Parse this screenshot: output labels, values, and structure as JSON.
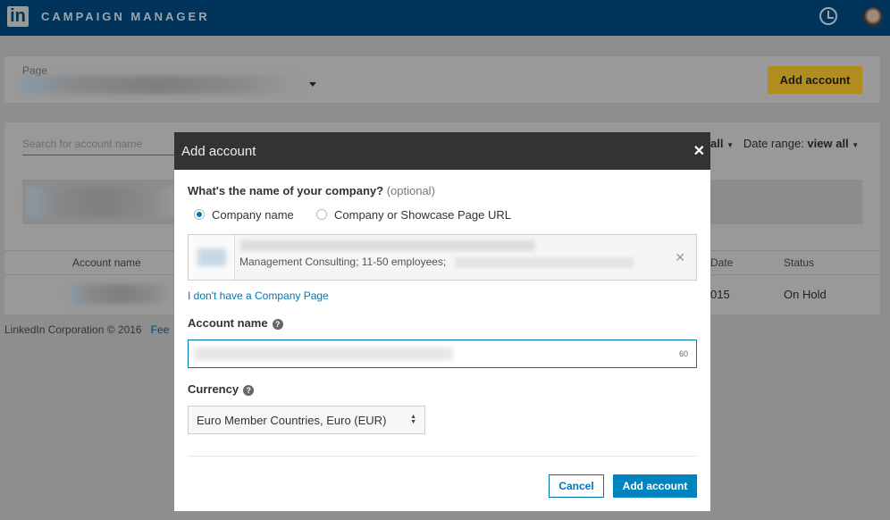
{
  "header": {
    "logo": "in",
    "title": "CAMPAIGN MANAGER",
    "icons": [
      "clock-icon",
      "avatar"
    ]
  },
  "page_selector": {
    "label": "Page"
  },
  "toolbar": {
    "add_account": "Add account"
  },
  "accounts": {
    "search_placeholder": "Search for account name",
    "filter_value": "all",
    "date_range_label": "Date range:",
    "date_range_value": "view all",
    "columns": [
      "Account name",
      "Date",
      "Status"
    ],
    "row": {
      "date": "015",
      "status": "On Hold"
    }
  },
  "footer": {
    "copyright": "LinkedIn Corporation © 2016",
    "feedback": "Fee"
  },
  "modal": {
    "title": "Add account",
    "question": "What's the name of your company?",
    "optional": "(optional)",
    "radio_options": [
      {
        "label": "Company name",
        "selected": true
      },
      {
        "label": "Company or Showcase Page URL",
        "selected": false
      }
    ],
    "company_details": "Management Consulting; 11-50 employees;",
    "no_page_link": "I don't have a Company Page",
    "account_name_label": "Account name",
    "account_name_remaining": "60",
    "currency_label": "Currency",
    "currency_value": "Euro Member Countries, Euro (EUR)",
    "cancel": "Cancel",
    "submit": "Add account"
  },
  "colors": {
    "accent": "#0077b5",
    "header": "#00345a",
    "modal_header": "#333333"
  }
}
